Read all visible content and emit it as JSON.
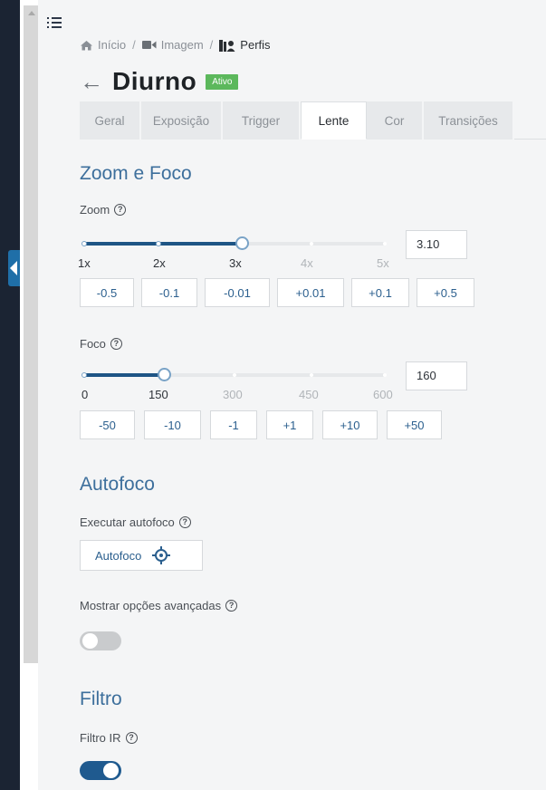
{
  "breadcrumb": {
    "home": "Início",
    "image": "Imagem",
    "profiles": "Perfis",
    "separator": "/"
  },
  "header": {
    "title": "Diurno",
    "status_badge": "Ativo"
  },
  "tabs": [
    {
      "label": "Geral",
      "active": false
    },
    {
      "label": "Exposição",
      "active": false
    },
    {
      "label": "Trigger",
      "active": false
    },
    {
      "label": "Lente",
      "active": true
    },
    {
      "label": "Cor",
      "active": false
    },
    {
      "label": "Transições",
      "active": false
    }
  ],
  "zoom_focus": {
    "section_title": "Zoom e Foco",
    "zoom": {
      "label": "Zoom",
      "value": "3.10",
      "ticks": [
        "1x",
        "2x",
        "3x",
        "4x",
        "5x"
      ],
      "range": [
        1,
        5
      ],
      "current": 3.1,
      "buttons": [
        "-0.5",
        "-0.1",
        "-0.01",
        "+0.01",
        "+0.1",
        "+0.5"
      ]
    },
    "focus": {
      "label": "Foco",
      "value": "160",
      "ticks": [
        "0",
        "150",
        "300",
        "450",
        "600"
      ],
      "range": [
        0,
        600
      ],
      "current": 160,
      "buttons": [
        "-50",
        "-10",
        "-1",
        "+1",
        "+10",
        "+50"
      ]
    }
  },
  "autofocus": {
    "section_title": "Autofoco",
    "run_label": "Executar autofoco",
    "button_label": "Autofoco",
    "advanced_label": "Mostrar opções avançadas",
    "advanced_enabled": false
  },
  "filter": {
    "section_title": "Filtro",
    "ir_label": "Filtro IR",
    "ir_enabled": true
  },
  "icons": {
    "help": "?",
    "back": "←"
  },
  "colors": {
    "accent": "#3d6f9c",
    "slider_fill": "#1e5585",
    "badge": "#5cb85c",
    "sidebar": "#1b2433"
  }
}
